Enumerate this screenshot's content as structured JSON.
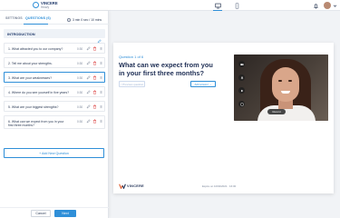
{
  "app": {
    "title": "VINCERE",
    "subtitle": "Heavy"
  },
  "panel": {
    "tabs": [
      {
        "label": "SETTINGS"
      },
      {
        "label": "QUESTIONS (6)"
      }
    ],
    "timer": "3 min 0 sec / 10 mins",
    "section_title": "INTRODUCTION",
    "questions": [
      {
        "text": "1. What attracted you to our company?",
        "time": "0:30"
      },
      {
        "text": "2. Tell me about your strengths.",
        "time": "0:30"
      },
      {
        "text": "3. What are your weaknesses?",
        "time": "0:30"
      },
      {
        "text": "4. Where do you see yourself in five years?",
        "time": "0:30"
      },
      {
        "text": "5. What are your biggest strengths?",
        "time": "0:30"
      },
      {
        "text": "6. What can we expect from you in your first three months?",
        "time": "0:30"
      }
    ],
    "add_question_label": "+ Add New Question",
    "cancel_label": "Cancel",
    "next_label": "Next"
  },
  "preview": {
    "question_number": "Question 1 of 6",
    "question_text": "What can we expect from you in your first three months?",
    "prev_label": "< Previous question",
    "answer_label": "Add answer →",
    "brand_name": "VINCERE",
    "expire_text": "Expire on 10/02/2021 · 16:00",
    "record_label": "Record"
  },
  "colors": {
    "accent": "#2f8fd8",
    "title": "#1f2f55"
  }
}
